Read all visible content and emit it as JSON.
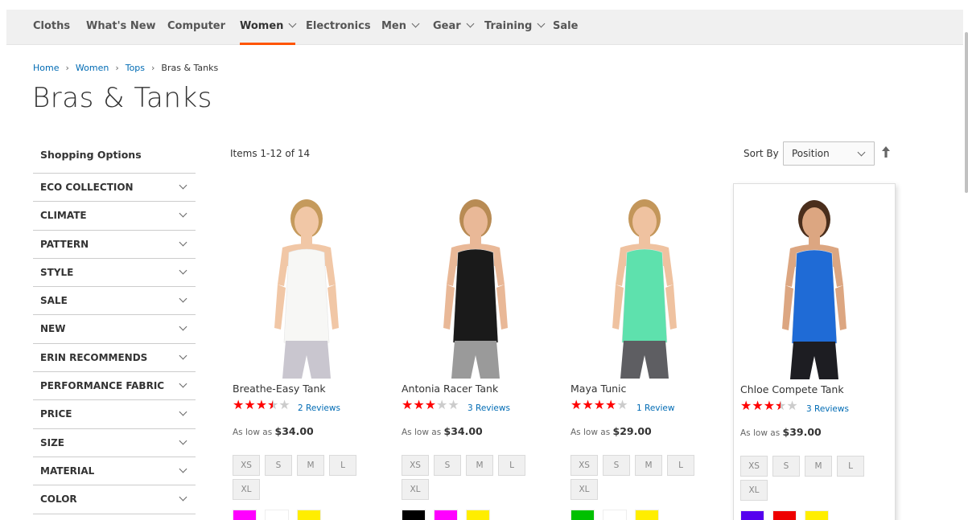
{
  "nav": {
    "items": [
      {
        "label": "Cloths",
        "has_dropdown": false,
        "active": false
      },
      {
        "label": "What's New",
        "has_dropdown": false,
        "active": false
      },
      {
        "label": "Computer",
        "has_dropdown": false,
        "active": false
      },
      {
        "label": "Women",
        "has_dropdown": true,
        "active": true
      },
      {
        "label": "Electronics",
        "has_dropdown": false,
        "active": false
      },
      {
        "label": "Men",
        "has_dropdown": true,
        "active": false
      },
      {
        "label": "Gear",
        "has_dropdown": true,
        "active": false
      },
      {
        "label": "Training",
        "has_dropdown": true,
        "active": false
      },
      {
        "label": "Sale",
        "has_dropdown": false,
        "active": false
      }
    ],
    "active_underline_color": "#ff5501"
  },
  "breadcrumb": {
    "items": [
      "Home",
      "Women",
      "Tops"
    ],
    "current": "Bras & Tanks"
  },
  "page_title": "Bras & Tanks",
  "sidebar": {
    "title": "Shopping Options",
    "filters": [
      "ECO COLLECTION",
      "CLIMATE",
      "PATTERN",
      "STYLE",
      "SALE",
      "NEW",
      "ERIN RECOMMENDS",
      "PERFORMANCE FABRIC",
      "PRICE",
      "SIZE",
      "MATERIAL",
      "COLOR"
    ]
  },
  "toolbar": {
    "count": "Items 1-12 of 14",
    "sort_label": "Sort By",
    "sort_value": "Position",
    "sort_direction_icon": "arrow-up-icon"
  },
  "products": [
    {
      "name": "Breathe-Easy Tank",
      "rating_stars": 3.5,
      "reviews": "2 Reviews",
      "price_prefix": "As low as",
      "price": "$34.00",
      "sizes": [
        "XS",
        "S",
        "M",
        "L",
        "XL"
      ],
      "swatches": [
        "#ff00ff",
        "#ffffff",
        "#ffee00"
      ],
      "image_colors": {
        "top": "#f7f7f5",
        "bottom": "#c9c6cf",
        "skin": "#f1c7a6",
        "hair": "#c59a5c"
      }
    },
    {
      "name": "Antonia Racer Tank",
      "rating_stars": 3,
      "reviews": "3 Reviews",
      "price_prefix": "As low as",
      "price": "$34.00",
      "sizes": [
        "XS",
        "S",
        "M",
        "L",
        "XL"
      ],
      "swatches": [
        "#000000",
        "#ff00ff",
        "#ffee00"
      ],
      "image_colors": {
        "top": "#1a1a1a",
        "bottom": "#9a9a9a",
        "skin": "#e9b897",
        "hair": "#b88b54"
      }
    },
    {
      "name": "Maya Tunic",
      "rating_stars": 4,
      "reviews": "1 Review",
      "price_prefix": "As low as",
      "price": "$29.00",
      "sizes": [
        "XS",
        "S",
        "M",
        "L",
        "XL"
      ],
      "swatches": [
        "#00c000",
        "#ffffff",
        "#ffee00"
      ],
      "image_colors": {
        "top": "#5ee1ad",
        "bottom": "#5e5e62",
        "skin": "#efc2a0",
        "hair": "#c3965a"
      }
    },
    {
      "name": "Chloe Compete Tank",
      "rating_stars": 3.5,
      "reviews": "3 Reviews",
      "price_prefix": "As low as",
      "price": "$39.00",
      "sizes": [
        "XS",
        "S",
        "M",
        "L",
        "XL"
      ],
      "swatches": [
        "#5500ee",
        "#ee0000",
        "#ffee00"
      ],
      "image_colors": {
        "top": "#1f6bd6",
        "bottom": "#1d1d22",
        "skin": "#dca681",
        "hair": "#4a2e1c"
      }
    }
  ],
  "colors": {
    "link": "#006bb4",
    "star": "#ff0000",
    "nav_bg": "#f0f0f0"
  }
}
